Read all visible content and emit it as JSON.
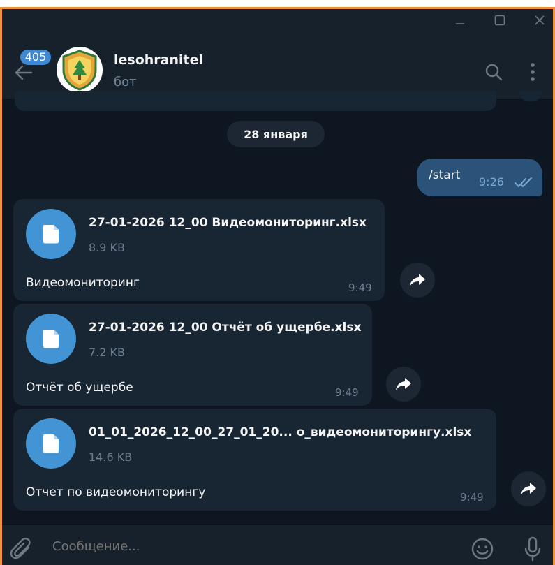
{
  "header": {
    "unread_count": "405",
    "chat_title": "lesohranitel",
    "chat_subtitle": "бот"
  },
  "date_separator": "28 января",
  "outgoing": {
    "text": "/start",
    "time": "9:26"
  },
  "messages": [
    {
      "file_name": "27-01-2026 12_00 Видеомониторинг.xlsx",
      "file_size": "8.9 KB",
      "caption": "Видеомониторинг",
      "time": "9:49"
    },
    {
      "file_name": "27-01-2026 12_00 Отчёт об ущербе.xlsx",
      "file_size": "7.2 KB",
      "caption": "Отчёт об ущербе",
      "time": "9:49"
    },
    {
      "file_name": "01_01_2026_12_00_27_01_20... о_видеомониторингу.xlsx",
      "file_size": "14.6 KB",
      "caption": "Отчет по видеомониторингу",
      "time": "9:49"
    }
  ],
  "composer": {
    "placeholder": "Сообщение..."
  },
  "colors": {
    "background": "#0e1621",
    "header": "#17212b",
    "incoming_bubble": "#182533",
    "outgoing_bubble": "#2b5278",
    "accent": "#4294d4",
    "frame": "#f0923a"
  }
}
